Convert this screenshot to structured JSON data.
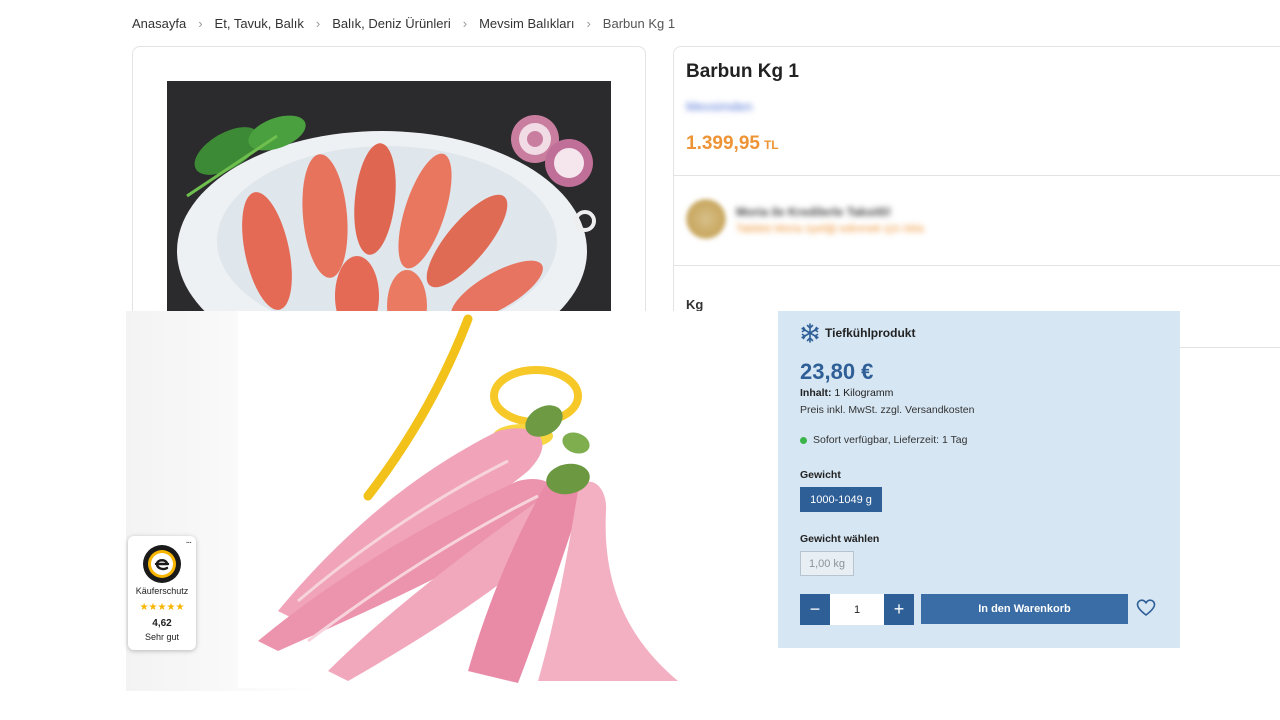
{
  "breadcrumb": [
    "Anasayfa",
    "Et, Tavuk, Balık",
    "Balık, Deniz Ürünleri",
    "Mevsim Balıkları",
    "Barbun Kg 1"
  ],
  "product": {
    "title": "Barbun Kg 1",
    "brand": "Mevsimden",
    "price": "1.399,95",
    "currency": "TL",
    "promo_title": "Moria ile Kredilerle Taksitli!",
    "promo_sub": "Tabldot Moria üyeliği edinmek için tıkla",
    "unit": "Kg"
  },
  "buy_panel": {
    "frozen_label": "Tiefkühlprodukt",
    "price": "23,80 €",
    "content_label": "Inhalt:",
    "content_value": " 1 Kilogramm",
    "tax_note": "Preis inkl. MwSt. zzgl. Versandkosten",
    "availability": "Sofort verfügbar, Lieferzeit: 1 Tag",
    "weight_label": "Gewicht",
    "weight_option": "1000-1049 g",
    "weight_choose_label": "Gewicht wählen",
    "weight_value": "1,00 kg",
    "qty_minus": "−",
    "qty_value": "1",
    "qty_plus": "+",
    "add_to_cart": "In den Warenkorb"
  },
  "trust_badge": {
    "more": "...",
    "title": "Käuferschutz",
    "stars": "★★★★★",
    "score": "4,62",
    "verdict": "Sehr gut"
  },
  "colors": {
    "accent_orange": "#ee9436",
    "panel_bg": "#d6e6f3",
    "brand_blue": "#2f5f97",
    "available_green": "#3bb54a",
    "star_gold": "#f7b500"
  }
}
